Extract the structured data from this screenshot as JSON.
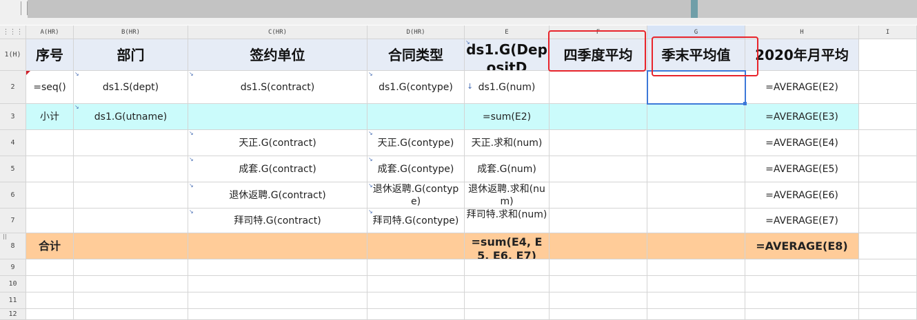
{
  "columns": [
    {
      "id": "A",
      "label": "A(HR)"
    },
    {
      "id": "B",
      "label": "B(HR)"
    },
    {
      "id": "C",
      "label": "C(HR)"
    },
    {
      "id": "D",
      "label": "D(HR)"
    },
    {
      "id": "E",
      "label": "E"
    },
    {
      "id": "F",
      "label": "F"
    },
    {
      "id": "G",
      "label": "G"
    },
    {
      "id": "H",
      "label": "H"
    },
    {
      "id": "I",
      "label": "I"
    }
  ],
  "rows": [
    "1(H)",
    "2",
    "3",
    "4",
    "5",
    "6",
    "7",
    "8",
    "9",
    "10",
    "11",
    "12"
  ],
  "corner_glyph": "⋮⋮⋮",
  "header": {
    "A": "序号",
    "B": "部门",
    "C": "签约单位",
    "D": "合同类型",
    "E": "ds1.G(DepositD",
    "F": "四季度平均",
    "G": "季末平均值",
    "H": "2020年月平均"
  },
  "row2": {
    "A": "=seq()",
    "B": "ds1.S(dept)",
    "C": "ds1.S(contract)",
    "D": "ds1.G(contype)",
    "E": "ds1.G(num)",
    "H": "=AVERAGE(E2)"
  },
  "row3": {
    "A": "小计",
    "B": "ds1.G(utname)",
    "E": "=sum(E2)",
    "H": "=AVERAGE(E3)"
  },
  "row4": {
    "C": "天正.G(contract)",
    "D": "天正.G(contype)",
    "E": "天正.求和(num)",
    "H": "=AVERAGE(E4)"
  },
  "row5": {
    "C": "成套.G(contract)",
    "D": "成套.G(contype)",
    "E": "成套.G(num)",
    "H": "=AVERAGE(E5)"
  },
  "row6": {
    "C": "退休返聘.G(contract)",
    "D": "退休返聘.G(contype)",
    "E": "退休返聘.求和(num)",
    "H": "=AVERAGE(E6)"
  },
  "row7": {
    "C": "拜司特.G(contract)",
    "D": "拜司特.G(contype)",
    "E": "拜司特.求和(num)",
    "H": "=AVERAGE(E7)"
  },
  "row8": {
    "A": "合计",
    "E": "=sum(E4, E5, E6, E7)",
    "H": "=AVERAGE(E8)"
  },
  "colors": {
    "header_bg": "#e6ecf6",
    "subtotal_bg": "#cbfbfb",
    "total_bg": "#ffcc99",
    "highlight_border": "#e8232a",
    "selection": "#3c78d8"
  },
  "selected_cell": "G2"
}
